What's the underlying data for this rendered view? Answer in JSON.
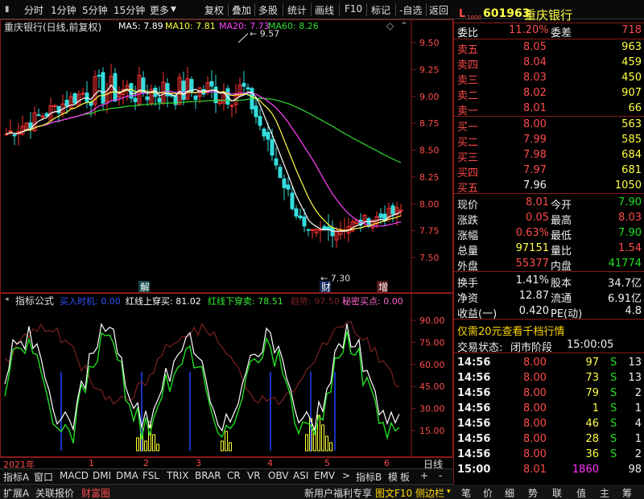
{
  "toolbar": {
    "items": [
      "分时",
      "1分钟",
      "5分钟",
      "15分钟",
      "更多",
      "复权",
      "叠加",
      "多股",
      "统计",
      "画线",
      "F10",
      "标记",
      "-自选",
      "返回"
    ]
  },
  "main_chart": {
    "title": "重庆银行(日线,前复权)",
    "ma_labels": [
      {
        "label": "MA5: 7.89",
        "color": "#ffffff"
      },
      {
        "label": "MA10: 7.81",
        "color": "#ffff44"
      },
      {
        "label": "MA20: 7.73",
        "color": "#ff44ff"
      },
      {
        "label": "MA60: 8.26",
        "color": "#33dd33"
      }
    ],
    "y_ticks": [
      "9.50",
      "9.25",
      "9.00",
      "8.75",
      "8.50",
      "8.25",
      "8.00",
      "7.75",
      "7.50"
    ],
    "high_marker": "9.57",
    "low_marker": "7.30",
    "signals": [
      "解",
      "财",
      "增"
    ]
  },
  "indicator": {
    "name": "指标公式",
    "buy_label": "买入时机: 0.00",
    "red_cross_label": "红线上穿买: 81.02",
    "green_cross_label": "红线下穿卖: 78.51",
    "trend_label": "趋势: 97.50",
    "secret_label": "秘密买点: 0.00",
    "y_ticks": [
      "90.00",
      "75.00",
      "60.00",
      "45.00",
      "30.00",
      "15.00"
    ]
  },
  "time_axis": {
    "year": "2021年",
    "months": [
      "1",
      "2",
      "3",
      "4",
      "5",
      "6"
    ],
    "period": "日线"
  },
  "tabs": [
    "指标A",
    "窗口",
    "MACD",
    "DMI",
    "DMA",
    "FSL",
    "TRIX",
    "BRAR",
    "CR",
    "VR",
    "OBV",
    "ASI",
    "EMV",
    ">",
    "指标B",
    "模",
    "板",
    "+",
    "-"
  ],
  "status_bar": {
    "left": [
      "扩展A",
      "关联报价",
      "财富圈"
    ],
    "news": "新用户福利专享",
    "right": [
      "图文F10",
      "侧边栏"
    ],
    "icons": [
      "笔",
      "价",
      "细",
      "势",
      "联",
      "值",
      "主",
      "筹"
    ]
  },
  "quote": {
    "flag": "L",
    "sub_flag": "1000",
    "code": "601963",
    "name": "重庆银行",
    "weibi_label": "委比",
    "weibi": "11.20%",
    "weicha_label": "委差",
    "weicha": "718",
    "asks": [
      {
        "label": "卖五",
        "price": "8.05",
        "vol": "963"
      },
      {
        "label": "卖四",
        "price": "8.04",
        "vol": "459"
      },
      {
        "label": "卖三",
        "price": "8.03",
        "vol": "450"
      },
      {
        "label": "卖二",
        "price": "8.02",
        "vol": "907"
      },
      {
        "label": "卖一",
        "price": "8.01",
        "vol": "66"
      }
    ],
    "bids": [
      {
        "label": "买一",
        "price": "8.00",
        "vol": "563"
      },
      {
        "label": "买二",
        "price": "7.99",
        "vol": "585"
      },
      {
        "label": "买三",
        "price": "7.98",
        "vol": "684"
      },
      {
        "label": "买四",
        "price": "7.97",
        "vol": "681"
      },
      {
        "label": "买五",
        "price": "7.96",
        "vol": "1050"
      }
    ],
    "stats": [
      {
        "l1": "现价",
        "v1": "8.01",
        "c1": "red",
        "l2": "今开",
        "v2": "7.90",
        "c2": "grn"
      },
      {
        "l1": "涨跌",
        "v1": "0.05",
        "c1": "red",
        "l2": "最高",
        "v2": "8.03",
        "c2": "red"
      },
      {
        "l1": "涨幅",
        "v1": "0.63%",
        "c1": "red",
        "l2": "最低",
        "v2": "7.90",
        "c2": "grn"
      },
      {
        "l1": "总量",
        "v1": "97151",
        "c1": "yel",
        "l2": "量比",
        "v2": "1.54",
        "c2": "red"
      },
      {
        "l1": "外盘",
        "v1": "55377",
        "c1": "red",
        "l2": "内盘",
        "v2": "41774",
        "c2": "grn"
      }
    ],
    "stats2": [
      {
        "l1": "换手",
        "v1": "1.41%",
        "l2": "股本",
        "v2": "34.7亿"
      },
      {
        "l1": "净资",
        "v1": "12.87",
        "l2": "流通",
        "v2": "6.91亿"
      },
      {
        "l1": "收益(一)",
        "v1": "0.420",
        "l2": "PE(动)",
        "v2": "4.8"
      }
    ],
    "promo": "仅需20元查看千档行情",
    "trade_state_label": "交易状态:",
    "trade_state": "闭市阶段",
    "trade_time": "15:00:05",
    "ticks": [
      {
        "t": "14:56",
        "p": "8.00",
        "v": "97",
        "s": "S",
        "n": "13"
      },
      {
        "t": "14:56",
        "p": "8.00",
        "v": "73",
        "s": "S",
        "n": "13"
      },
      {
        "t": "14:56",
        "p": "8.00",
        "v": "79",
        "s": "S",
        "n": "2"
      },
      {
        "t": "14:56",
        "p": "8.00",
        "v": "1",
        "s": "S",
        "n": "1"
      },
      {
        "t": "14:56",
        "p": "8.00",
        "v": "46",
        "s": "S",
        "n": "4"
      },
      {
        "t": "14:56",
        "p": "8.00",
        "v": "28",
        "s": "S",
        "n": "1"
      },
      {
        "t": "14:56",
        "p": "8.00",
        "v": "36",
        "s": "S",
        "n": "2"
      },
      {
        "t": "15:00",
        "p": "8.01",
        "v": "1860",
        "s": "",
        "n": "98"
      }
    ]
  }
}
